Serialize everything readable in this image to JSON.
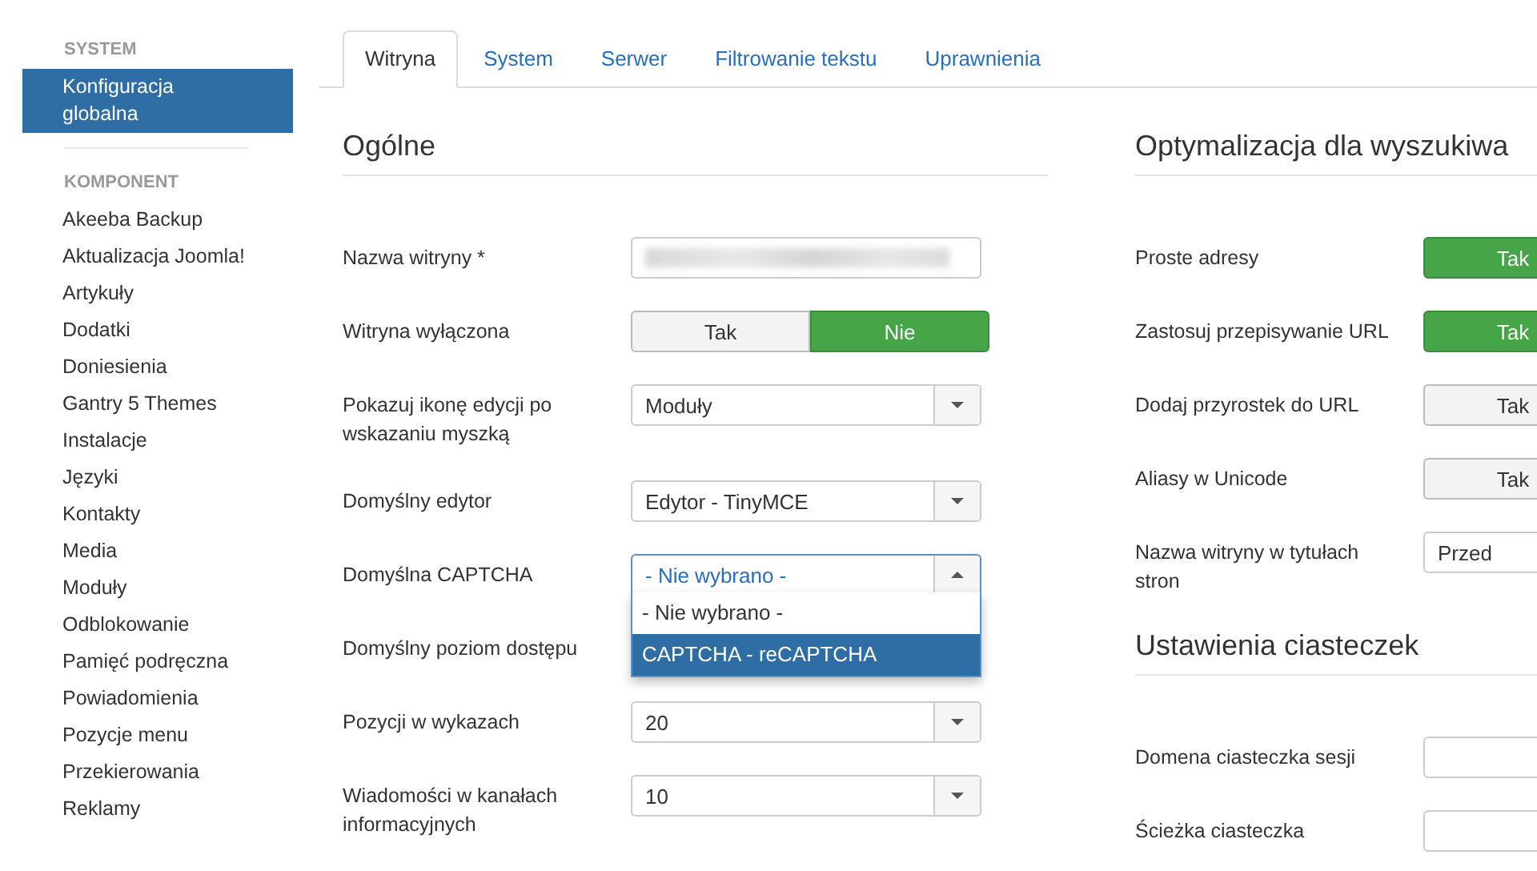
{
  "sidebar": {
    "sections": [
      {
        "heading": "SYSTEM",
        "items": [
          {
            "label": "Konfiguracja globalna",
            "selected": true
          }
        ]
      },
      {
        "heading": "KOMPONENT",
        "items": [
          {
            "label": "Akeeba Backup",
            "selected": false
          },
          {
            "label": "Aktualizacja Joomla!",
            "selected": false
          },
          {
            "label": "Artykuły",
            "selected": false
          },
          {
            "label": "Dodatki",
            "selected": false
          },
          {
            "label": "Doniesienia",
            "selected": false
          },
          {
            "label": "Gantry 5 Themes",
            "selected": false
          },
          {
            "label": "Instalacje",
            "selected": false
          },
          {
            "label": "Języki",
            "selected": false
          },
          {
            "label": "Kontakty",
            "selected": false
          },
          {
            "label": "Media",
            "selected": false
          },
          {
            "label": "Moduły",
            "selected": false
          },
          {
            "label": "Odblokowanie",
            "selected": false
          },
          {
            "label": "Pamięć podręczna",
            "selected": false
          },
          {
            "label": "Powiadomienia",
            "selected": false
          },
          {
            "label": "Pozycje menu",
            "selected": false
          },
          {
            "label": "Przekierowania",
            "selected": false
          },
          {
            "label": "Reklamy",
            "selected": false
          }
        ]
      }
    ]
  },
  "tabs": [
    {
      "label": "Witryna",
      "selected": true
    },
    {
      "label": "System",
      "selected": false
    },
    {
      "label": "Serwer",
      "selected": false
    },
    {
      "label": "Filtrowanie tekstu",
      "selected": false
    },
    {
      "label": "Uprawnienia",
      "selected": false
    }
  ],
  "columns": [
    {
      "sections": [
        {
          "heading": "Ogólne",
          "fields": [
            {
              "kind": "blurred",
              "label": "Nazwa witryny *"
            },
            {
              "kind": "toggle",
              "label": "Witryna wyłączona",
              "options": [
                {
                  "label": "Tak",
                  "selected": false
                },
                {
                  "label": "Nie",
                  "selected": true
                }
              ]
            },
            {
              "kind": "select",
              "label": "Pokazuj ikonę edycji po wskazaniu myszką",
              "value": "Moduły",
              "expanded": false
            },
            {
              "kind": "select",
              "label": "Domyślny edytor",
              "value": "Edytor - TinyMCE",
              "expanded": false
            },
            {
              "kind": "select",
              "label": "Domyślna CAPTCHA",
              "value": "- Nie wybrano -",
              "expanded": true,
              "options": [
                {
                  "label": "- Nie wybrano -",
                  "highlighted": false
                },
                {
                  "label": "CAPTCHA - reCAPTCHA",
                  "highlighted": true
                }
              ]
            },
            {
              "kind": "none",
              "label": "Domyślny poziom dostępu"
            },
            {
              "kind": "select",
              "label": "Pozycji w wykazach",
              "value": "20",
              "expanded": false
            },
            {
              "kind": "select",
              "label": "Wiadomości w kanałach informacyjnych",
              "value": "10",
              "expanded": false
            }
          ]
        }
      ]
    },
    {
      "sections": [
        {
          "heading": "Optymalizacja dla wyszukiwa",
          "fields": [
            {
              "kind": "toggle",
              "label": "Proste adresy",
              "options": [
                {
                  "label": "Tak",
                  "selected": true
                }
              ]
            },
            {
              "kind": "toggle",
              "label": "Zastosuj przepisywanie URL",
              "options": [
                {
                  "label": "Tak",
                  "selected": true
                }
              ]
            },
            {
              "kind": "toggle",
              "label": "Dodaj przyrostek do URL",
              "options": [
                {
                  "label": "Tak",
                  "selected": false
                }
              ]
            },
            {
              "kind": "toggle",
              "label": "Aliasy w Unicode",
              "options": [
                {
                  "label": "Tak",
                  "selected": false
                }
              ]
            },
            {
              "kind": "select",
              "label": "Nazwa witryny w tytułach stron",
              "value": "Przed",
              "expanded": false
            }
          ]
        },
        {
          "heading": "Ustawienia ciasteczek",
          "fields": [
            {
              "kind": "text",
              "label": "Domena ciasteczka sesji"
            },
            {
              "kind": "text",
              "label": "Ścieżka ciasteczka"
            }
          ]
        }
      ]
    }
  ]
}
